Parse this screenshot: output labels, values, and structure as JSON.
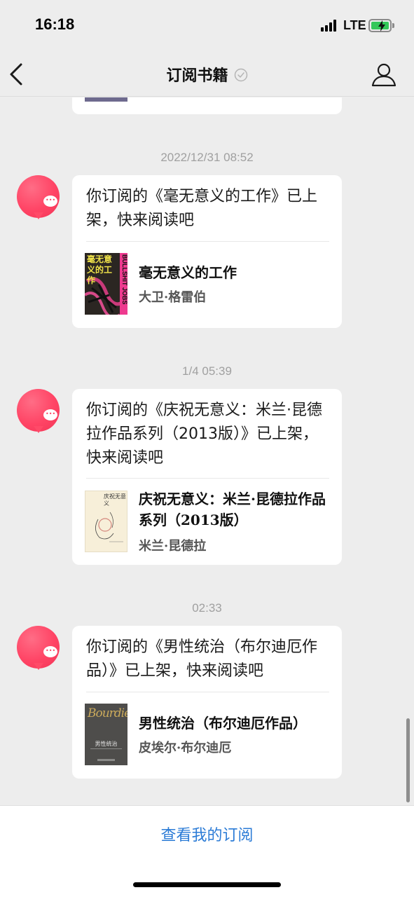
{
  "status_bar": {
    "time": "16:18",
    "network": "LTE"
  },
  "nav": {
    "title": "订阅书籍"
  },
  "messages": [
    {
      "timestamp": "2022/12/31 08:52",
      "text": "你订阅的《毫无意义的工作》已上架，快来阅读吧",
      "book_title": "毫无意义的工作",
      "book_author": "大卫·格雷伯",
      "cover_text": "毫无意义的工作",
      "cover_side_text": "BULLSHIT JOBS"
    },
    {
      "timestamp": "1/4 05:39",
      "text": "你订阅的《庆祝无意义：米兰·昆德拉作品系列（2013版）》已上架，快来阅读吧",
      "book_title": "庆祝无意义：米兰·昆德拉作品系列（2013版）",
      "book_author": "米兰·昆德拉",
      "cover_text": "庆祝无意义"
    },
    {
      "timestamp": "02:33",
      "text": "你订阅的《男性统治（布尔迪厄作品）》已上架，快来阅读吧",
      "book_title": "男性统治（布尔迪厄作品）",
      "book_author": "皮埃尔·布尔迪厄",
      "cover_text": "男性统治",
      "cover_script": "Bourdieu"
    }
  ],
  "bottom": {
    "button_label": "查看我的订阅"
  },
  "colors": {
    "accent": "#2b7bd6",
    "avatar": "#ff4465",
    "battery": "#34c759"
  },
  "icons": [
    "back-arrow-icon",
    "verified-check-icon",
    "profile-icon",
    "chat-bubble-icon",
    "battery-icon",
    "signal-icon"
  ]
}
